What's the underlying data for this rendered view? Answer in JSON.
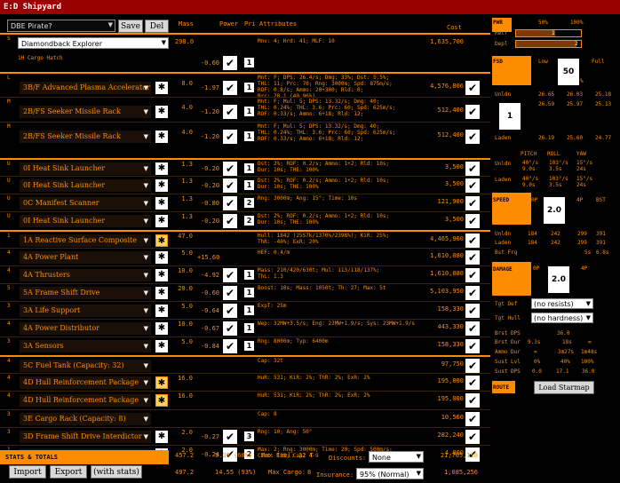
{
  "title": "E:D Shipyard",
  "build_name": "DBE Pirate?",
  "save_label": "Save",
  "del_label": "Del",
  "ship": "Diamondback Explorer",
  "col": {
    "mass": "Mass",
    "power": "Power",
    "pri": "Pri",
    "attributes": "Attributes",
    "cost": "Cost"
  },
  "hull": {
    "slot": "S",
    "mass": "298.0",
    "attr": "Mnv: 4; Hrd: 41; MLF: 10",
    "cost": "1,635,700"
  },
  "cargo_hatch": {
    "label": "1H Cargo Hatch",
    "power": "-0.60",
    "pri": "1"
  },
  "modules": [
    {
      "slot": "L",
      "name": "3B/F Advanced Plasma Accelerator",
      "mass": "8.0",
      "power": "-1.97",
      "pri": "1",
      "attr": "Mnt: F; DPS: 26.4/s; Dmg: 33%; Dst: 5.5%;\nTHL: 11; Prc: 70; Rng: 3000m; Spd: 875m/s;\nROF: 0.8/s; Ammo: 20+300; Rld: 0;\nBrc: 28.1 (40.96%)",
      "cost": "4,576,806",
      "hl": true,
      "wt": "w"
    },
    {
      "slot": "M",
      "name": "2B/FS Seeker Missile Rack",
      "mass": "4.0",
      "power": "-1.20",
      "pri": "1",
      "attr": "Mnt: F; Mul: 5; DPS: 13.32/s; Dmg: 40;\nTHL: 0.24%; THL: 3.6; Prc: 60; Spd: 625m/s;\nROF: 0.33/s; Ammo: 6+18; Rld: 12;",
      "cost": "512,400",
      "wt": "w"
    },
    {
      "slot": "M",
      "name": "2B/FS Seeker Missile Rack",
      "mass": "4.0",
      "power": "-1.20",
      "pri": "1",
      "attr": "Mnt: F; Mul: 5; DPS: 13.32/s; Dmg: 40;\nTHL: 0.24%; THL: 3.6; Prc: 60; Spd: 625m/s;\nROF: 0.33/s; Ammo: 6+18; Rld: 12;",
      "cost": "512,400",
      "wt": "w"
    },
    {
      "slot": "U",
      "name": "0I Heat Sink Launcher",
      "mass": "1.3",
      "power": "-0.20",
      "pri": "1",
      "attr": "Dst: 2%; ROF: 0.2/s; Ammo: 1+2; Rld: 10s;\nDur: 10s; THE: 100%",
      "cost": "3,500",
      "hl": true,
      "wt": "w"
    },
    {
      "slot": "U",
      "name": "0I Heat Sink Launcher",
      "mass": "1.3",
      "power": "-0.20",
      "pri": "1",
      "attr": "Dst: 2%; ROF: 0.2/s; Ammo: 1+2; Rld: 10s;\nDur: 10s; THE: 100%",
      "cost": "3,500",
      "wt": "w"
    },
    {
      "slot": "U",
      "name": "0C Manifest Scanner",
      "mass": "1.3",
      "power": "-0.80",
      "pri": "2",
      "attr": "Rng: 3000m; Ang: 15°; Time: 10s",
      "cost": "121,900",
      "wt": "w"
    },
    {
      "slot": "U",
      "name": "0I Heat Sink Launcher",
      "mass": "1.3",
      "power": "-0.20",
      "pri": "2",
      "attr": "Dst: 2%; ROF: 0.2/s; Ammo: 1+2; Rld: 10s;\nDur: 10s; THE: 100%",
      "cost": "3,500",
      "wt": "w"
    },
    {
      "slot": "1",
      "name": "1A Reactive Surface Composite",
      "mass": "47.0",
      "power": "",
      "pri": "",
      "attr": "Hull: 1842 (2557k/1370%/2398%); KiR: 25%;\nThR: -40%; ExR: 20%",
      "cost": "4,465,960",
      "hl": true,
      "wt": "y"
    },
    {
      "slot": "4",
      "name": "4A Power Plant",
      "mass": "5.0",
      "power": "+15.60",
      "pri": "",
      "attr": "HEF: 0.4/m",
      "cost": "1,610,080",
      "wt": "w"
    },
    {
      "slot": "4",
      "name": "4A Thrusters",
      "mass": "10.0",
      "power": "-4.92",
      "pri": "1",
      "attr": "Mass: 210/420/630t; Mul: 113/118/137%;\nThL: 1.3",
      "cost": "1,610,080",
      "wt": "w"
    },
    {
      "slot": "5",
      "name": "5A Frame Shift Drive",
      "mass": "20.0",
      "power": "-0.60",
      "pri": "1",
      "attr": "Boost: 10s; Mass: 1050t; Th: 27; Max: 5t",
      "cost": "5,103,950",
      "wt": "w"
    },
    {
      "slot": "3",
      "name": "3A Life Support",
      "mass": "5.0",
      "power": "-0.64",
      "pri": "1",
      "attr": "ExpT: 25m",
      "cost": "158,330",
      "wt": "w"
    },
    {
      "slot": "4",
      "name": "4A Power Distributor",
      "mass": "10.0",
      "power": "-0.67",
      "pri": "1",
      "attr": "Wep: 32MW+3.5/s; Eng: 23MW+1.9/s; Sys: 23MW+1.9/s",
      "cost": "443,330",
      "wt": "w"
    },
    {
      "slot": "3",
      "name": "3A Sensors",
      "mass": "5.0",
      "power": "-0.84",
      "pri": "1",
      "attr": "Rng: 8000m; Typ: 6400m",
      "cost": "158,330",
      "wt": "w"
    },
    {
      "slot": "4",
      "name": "5C Fuel Tank (Capacity: 32)",
      "mass": "",
      "power": "",
      "pri": "",
      "attr": "Cap: 32t",
      "cost": "97,750",
      "hl": true,
      "wt": "none"
    },
    {
      "slot": "4",
      "name": "4D Hull Reinforcement Package",
      "mass": "16.0",
      "power": "",
      "pri": "",
      "attr": "HuR: 531; KiR: 2%; ThR: 2%; ExR: 2%",
      "cost": "195,000",
      "wt": "y"
    },
    {
      "slot": "4",
      "name": "4D Hull Reinforcement Package",
      "mass": "16.0",
      "power": "",
      "pri": "",
      "attr": "HuR: 531; KiR: 2%; ThR: 2%; ExR: 2%",
      "cost": "195,000",
      "wt": "y"
    },
    {
      "slot": "3",
      "name": "3E Cargo Rack (Capacity: 8)",
      "mass": "",
      "power": "",
      "pri": "",
      "attr": "Cap: 8",
      "cost": "10,560",
      "wt": "none"
    },
    {
      "slot": "3",
      "name": "3D Frame Shift Drive Interdictor",
      "mass": "2.0",
      "power": "-0.27",
      "pri": "3",
      "attr": "Rng: 10; Ang: 50°",
      "cost": "282,240",
      "wt": "w"
    },
    {
      "slot": "1",
      "name": "1B Hatch Breaker Limpet Controller",
      "mass": "2.0",
      "power": "-0.24",
      "pri": "2",
      "attr": "Max: 2; Rng: 3000m; Time: 20; Spd: 500m/s;\nCInt: 135; Cap: 4-9",
      "cost": "4,800",
      "wt": "w"
    }
  ],
  "stats": {
    "label": "STATS & TOTALS",
    "mass1": "457.2",
    "power1": "9.38 (60%)",
    "maxfuel_label": "Max Fuel:",
    "maxfuel": "32 T",
    "discounts_label": "Discounts:",
    "discounts": "None",
    "cost1": "21,705,110",
    "mass2": "497.2",
    "power2": "14.55 (93%)",
    "maxcargo_label": "Max Cargo:",
    "maxcargo": "8",
    "insurance_label": "Insurance:",
    "insurance": "95% (Normal)",
    "cost2": "1,085,256"
  },
  "buttons": {
    "import": "Import",
    "export": "Export",
    "withstats": "(with stats)"
  },
  "side": {
    "pwr": {
      "label": "PWR",
      "p50": "50%",
      "p100": "100%",
      "retr": "Retr",
      "depl": "Depl",
      "retr_v": "1",
      "depl_v": "2",
      "retr_fill": 0.6,
      "depl_fill": 0.93
    },
    "fsd": {
      "label": "FSD",
      "low": "Low",
      "full": "Full",
      "pct": "50",
      "unit": "%",
      "unldn": "Unldn",
      "laden": "Laden",
      "box": "1",
      "rows": [
        [
          "26.65",
          "26.03",
          "25.18"
        ],
        [
          "26.59",
          "25.97",
          "25.13"
        ],
        [
          "26.19",
          "25.60",
          "24.77"
        ]
      ]
    },
    "mnv": {
      "label": "MNV",
      "pitch": "PITCH",
      "roll": "ROLL",
      "yaw": "YAW",
      "unldn": "Unldn",
      "laden": "Laden",
      "u": [
        "40°/s",
        "103°/s",
        "15°/s"
      ],
      "u2": [
        "9.0s",
        "3.5s",
        "24s"
      ],
      "l": [
        "40°/s",
        "103°/s",
        "15°/s"
      ],
      "l2": [
        "9.0s",
        "3.5s",
        "24s"
      ]
    },
    "speed": {
      "label": "SPEED",
      "p0": "0P",
      "p4": "4P",
      "bst": "BST",
      "box": "2.0",
      "unldn": "Unldn",
      "laden": "Laden",
      "bstfrq": "Bst Frq",
      "u": [
        "184",
        "242",
        "299",
        "391"
      ],
      "l": [
        "184",
        "242",
        "299",
        "391"
      ],
      "b": "5s",
      "b2": "6.8s"
    },
    "damage": {
      "label": "DAMAGE",
      "p0": "0P",
      "p4": "4P",
      "box": "2.0",
      "tgtdef": "Tgt Def",
      "tgthull": "Tgt Hull",
      "noresists": "(no resists)",
      "nohardness": "(no hardness)",
      "brstdps": "Brst DPS",
      "brstdps_v": "36.0",
      "brstdur": "Brst Dur",
      "brstdur_v": [
        "9.3s",
        "18s",
        "∞"
      ],
      "ammodur": "Ammo Dur",
      "ammodur_v": [
        "∞",
        "3m27s",
        "1m48s"
      ],
      "sustlvl": "Sust Lvl",
      "sustlvl_v": [
        "0%",
        "40%",
        "100%"
      ],
      "sustdps": "Sust DPS",
      "sustdps_v": [
        "0.0",
        "17.1",
        "36.0"
      ]
    },
    "route": {
      "label": "ROUTE",
      "btn": "Load Starmap"
    }
  }
}
